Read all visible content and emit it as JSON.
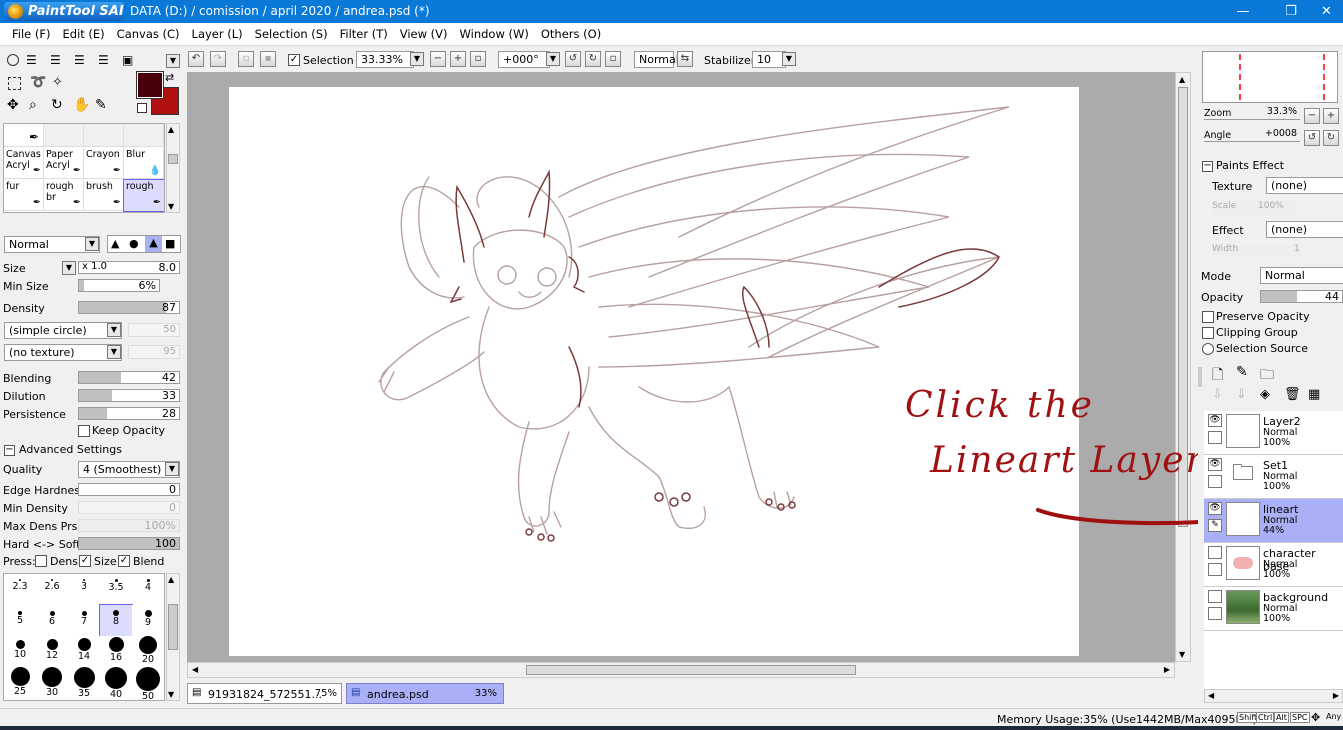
{
  "window": {
    "logo_text": "PaintTool SAI",
    "title": "DATA (D:) / comission / april 2020 / andrea.psd (*)",
    "minimize": "—",
    "restore": "❐",
    "close": "✕"
  },
  "menu": [
    "File (F)",
    "Edit (E)",
    "Canvas (C)",
    "Layer (L)",
    "Selection (S)",
    "Filter (T)",
    "View (V)",
    "Window (W)",
    "Others (O)"
  ],
  "toolbar": {
    "selection_label": "Selection",
    "selection_checked": true,
    "zoom": "33.33%",
    "rotation": "+000°",
    "blend_mode": "Normal",
    "stabilizer_label": "Stabilizer",
    "stabilizer_value": "10"
  },
  "colors": {
    "primary": "#4a0008",
    "secondary": "#b01010",
    "accent": "#0a78d7",
    "selected_layer": "#aab0f5",
    "annotation": "#a01010"
  },
  "brushes": {
    "top_row": [
      "Canvas Acryl",
      "Paper Acryl",
      "Crayon",
      "Blur"
    ],
    "bottom_row": [
      "fur",
      "rough br",
      "brush",
      "rough"
    ]
  },
  "brush_settings": {
    "blend_mode": "Normal",
    "size_label": "Size",
    "size_mult": "x 1.0",
    "size_value": "8.0",
    "min_size_label": "Min Size",
    "min_size_value": "6%",
    "min_size_level": 0.06,
    "density_label": "Density",
    "density_value": "87",
    "density_level": 0.87,
    "shape": "(simple circle)",
    "shape_value": "50",
    "texture": "(no texture)",
    "texture_value": "95",
    "blending_label": "Blending",
    "blending_value": "42",
    "blending_level": 0.42,
    "dilution_label": "Dilution",
    "dilution_value": "33",
    "dilution_level": 0.33,
    "persistence_label": "Persistence",
    "persistence_value": "28",
    "persistence_level": 0.28,
    "keep_opacity": "Keep Opacity",
    "advanced_label": "Advanced Settings",
    "quality_label": "Quality",
    "quality_value": "4 (Smoothest)",
    "edge_hardness_label": "Edge Hardness",
    "edge_hardness_value": "0",
    "min_density_label": "Min Density",
    "min_density_value": "0",
    "max_dens_label": "Max Dens Prs.",
    "max_dens_value": "100%",
    "hard_soft_label": "Hard <-> Soft",
    "hard_soft_value": "100",
    "hard_soft_level": 1.0,
    "press_label": "Press:",
    "press_dens": "Dens",
    "press_size": "Size",
    "press_blend": "Blend"
  },
  "brush_sizes": {
    "row1": [
      "2.3",
      "2.6",
      "3",
      "3.5",
      "4"
    ],
    "row2": [
      "5",
      "6",
      "7",
      "8",
      "9"
    ],
    "row3": [
      "10",
      "12",
      "14",
      "16",
      "20"
    ],
    "row4": [
      "25",
      "30",
      "35",
      "40",
      "50"
    ],
    "selected": "8"
  },
  "navigator": {
    "zoom_label": "Zoom",
    "zoom_value": "33.3%",
    "angle_label": "Angle",
    "angle_value": "+0008"
  },
  "layer_panel": {
    "paints_effect": "Paints Effect",
    "texture_label": "Texture",
    "texture_value": "(none)",
    "scale_label": "Scale",
    "scale_value": "100%",
    "effect_label": "Effect",
    "effect_value": "(none)",
    "width_label": "Width",
    "width_value": "1",
    "mode_label": "Mode",
    "mode_value": "Normal",
    "opacity_label": "Opacity",
    "opacity_value": "44",
    "opacity_level": 0.44,
    "preserve_opacity": "Preserve Opacity",
    "clipping_group": "Clipping Group",
    "selection_source": "Selection Source",
    "layers": [
      {
        "name": "Layer2",
        "mode": "Normal",
        "opacity": "100%"
      },
      {
        "name": "Set1",
        "mode": "Normal",
        "opacity": "100%"
      },
      {
        "name": "lineart",
        "mode": "Normal",
        "opacity": "44%"
      },
      {
        "name": "character base",
        "mode": "Normal",
        "opacity": "100%"
      },
      {
        "name": "background",
        "mode": "Normal",
        "opacity": "100%"
      }
    ]
  },
  "annotation": {
    "line1": "Click the",
    "line2": "Lineart Layer"
  },
  "tabs": [
    {
      "name": "91931824_572551...",
      "zoom": "75%"
    },
    {
      "name": "andrea.psd",
      "zoom": "33%"
    }
  ],
  "status": {
    "memory": "Memory Usage:35% (Use1442MB/Max4095MB)",
    "keys": [
      "Shift",
      "Ctrl",
      "Alt",
      "SPC"
    ],
    "any": "Any"
  }
}
